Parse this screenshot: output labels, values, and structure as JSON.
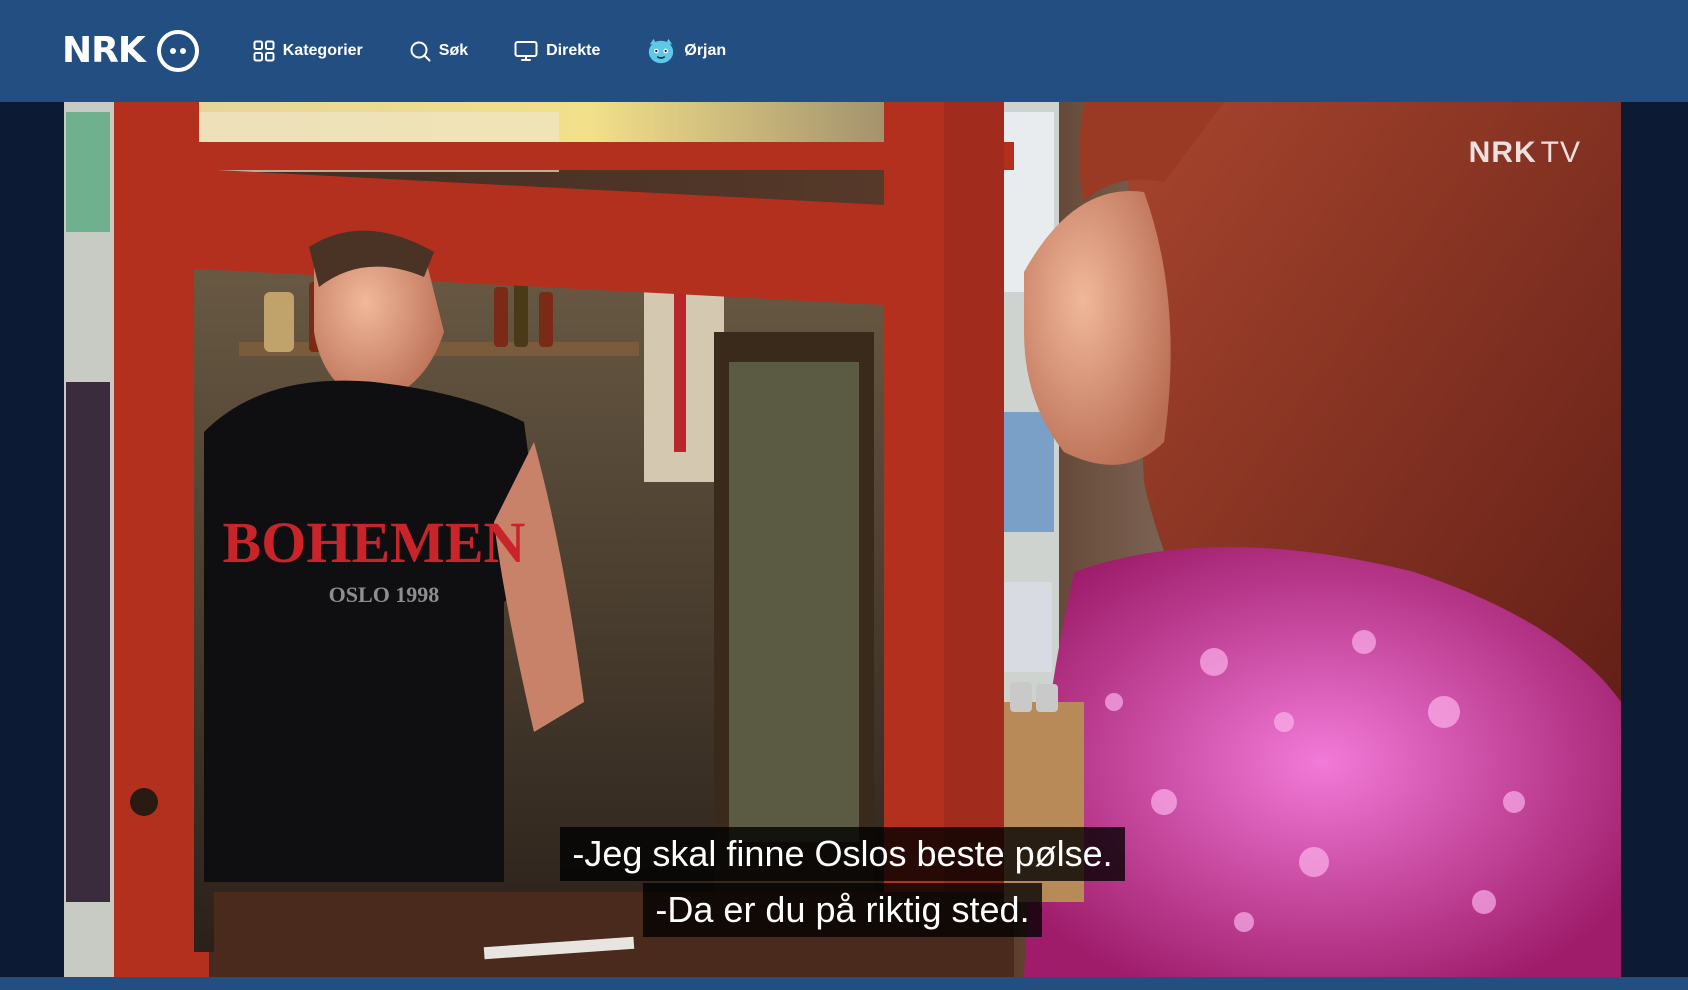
{
  "header": {
    "logo_text": "NRK",
    "nav": [
      {
        "label": "Kategorier",
        "icon": "grid-icon"
      },
      {
        "label": "Søk",
        "icon": "search-icon"
      },
      {
        "label": "Direkte",
        "icon": "tv-icon"
      },
      {
        "label": "Ørjan",
        "icon": "profile-avatar-icon"
      }
    ]
  },
  "player": {
    "watermark_brand": "NRK",
    "watermark_suffix": "TV",
    "subtitles": [
      "-Jeg skal finne Oslos beste pølse.",
      "-Da er du på riktig sted."
    ],
    "scene_shirt_text": "BOHEMEN",
    "scene_shirt_subtext": "OSLO 1998"
  },
  "colors": {
    "header_bg": "#234e82",
    "page_bg": "#0c1b33",
    "kiosk_red": "#c23a2a"
  }
}
